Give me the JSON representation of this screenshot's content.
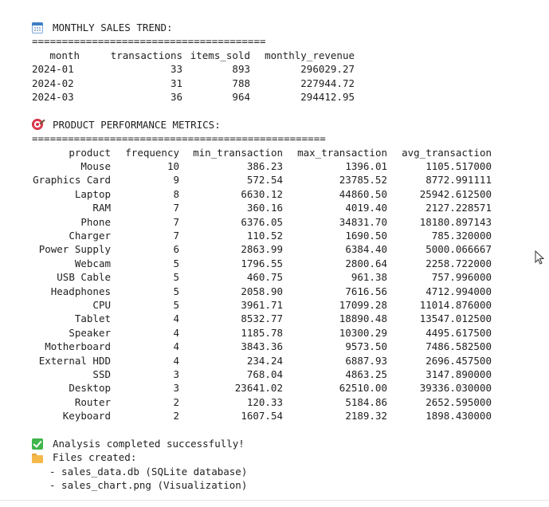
{
  "monthly": {
    "title": "MONTHLY SALES TREND:",
    "rule": "=======================================",
    "headers": [
      "month",
      "transactions",
      "items_sold",
      "monthly_revenue"
    ],
    "rows": [
      [
        "2024-01",
        "33",
        "893",
        "296029.27"
      ],
      [
        "2024-02",
        "31",
        "788",
        "227944.72"
      ],
      [
        "2024-03",
        "36",
        "964",
        "294412.95"
      ]
    ]
  },
  "product": {
    "title": "PRODUCT PERFORMANCE METRICS:",
    "rule": "=================================================",
    "headers": [
      "product",
      "frequency",
      "min_transaction",
      "max_transaction",
      "avg_transaction"
    ],
    "rows": [
      [
        "Mouse",
        "10",
        "386.23",
        "1396.01",
        "1105.517000"
      ],
      [
        "Graphics Card",
        "9",
        "572.54",
        "23785.52",
        "8772.991111"
      ],
      [
        "Laptop",
        "8",
        "6630.12",
        "44860.50",
        "25942.612500"
      ],
      [
        "RAM",
        "7",
        "360.16",
        "4019.40",
        "2127.228571"
      ],
      [
        "Phone",
        "7",
        "6376.05",
        "34831.70",
        "18180.897143"
      ],
      [
        "Charger",
        "7",
        "110.52",
        "1690.50",
        "785.320000"
      ],
      [
        "Power Supply",
        "6",
        "2863.99",
        "6384.40",
        "5000.066667"
      ],
      [
        "Webcam",
        "5",
        "1796.55",
        "2800.64",
        "2258.722000"
      ],
      [
        "USB Cable",
        "5",
        "460.75",
        "961.38",
        "757.996000"
      ],
      [
        "Headphones",
        "5",
        "2058.90",
        "7616.56",
        "4712.994000"
      ],
      [
        "CPU",
        "5",
        "3961.71",
        "17099.28",
        "11014.876000"
      ],
      [
        "Tablet",
        "4",
        "8532.77",
        "18890.48",
        "13547.012500"
      ],
      [
        "Speaker",
        "4",
        "1185.78",
        "10300.29",
        "4495.617500"
      ],
      [
        "Motherboard",
        "4",
        "3843.36",
        "9573.50",
        "7486.582500"
      ],
      [
        "External HDD",
        "4",
        "234.24",
        "6887.93",
        "2696.457500"
      ],
      [
        "SSD",
        "3",
        "768.04",
        "4863.25",
        "3147.890000"
      ],
      [
        "Desktop",
        "3",
        "23641.02",
        "62510.00",
        "39336.030000"
      ],
      [
        "Router",
        "2",
        "120.33",
        "5184.86",
        "2652.595000"
      ],
      [
        "Keyboard",
        "2",
        "1607.54",
        "2189.32",
        "1898.430000"
      ]
    ]
  },
  "status": {
    "completed": "Analysis completed successfully!",
    "files_label": "Files created:",
    "files": [
      "- sales_data.db (SQLite database)",
      "- sales_chart.png (Visualization)"
    ]
  },
  "icons": {
    "monthly": "calendar-icon",
    "product": "target-icon",
    "completed": "check-mark-icon",
    "files": "folder-icon"
  }
}
